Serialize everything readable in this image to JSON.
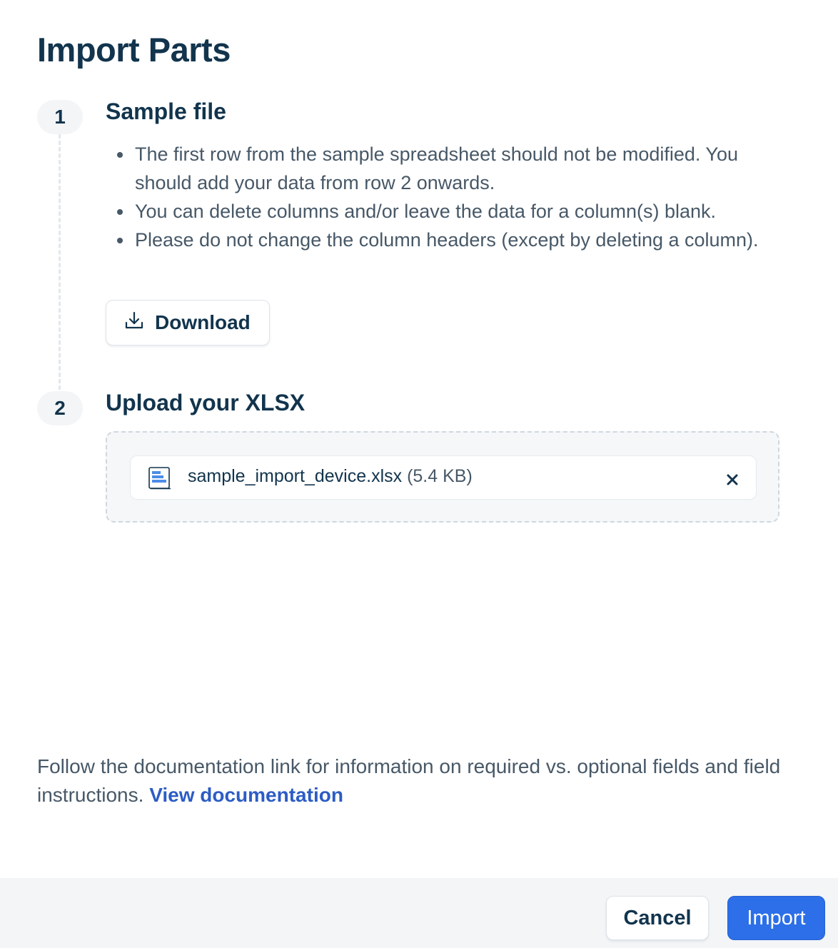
{
  "dialog": {
    "title": "Import Parts"
  },
  "steps": [
    {
      "number": "1",
      "title": "Sample file",
      "bullets": [
        "The first row from the sample spreadsheet should not be modified. You should add your data from row 2 onwards.",
        "You can delete columns and/or leave the data for a column(s) blank.",
        "Please do not change the column headers (except by deleting a column)."
      ],
      "download_label": "Download",
      "download_icon": "download-icon"
    },
    {
      "number": "2",
      "title": "Upload your XLSX",
      "file": {
        "name": "sample_import_device.xlsx",
        "size": "(5.4 KB)",
        "icon": "spreadsheet-file-icon",
        "remove_icon": "close-icon"
      }
    }
  ],
  "documentation": {
    "text": "Follow the documentation link for information on required vs. optional fields and field instructions.",
    "link_label": "View documentation"
  },
  "footer": {
    "cancel_label": "Cancel",
    "import_label": "Import"
  },
  "colors": {
    "primary": "#2c6fe8",
    "heading": "#12344d",
    "body_text": "#475867",
    "link": "#2c5cc5"
  }
}
